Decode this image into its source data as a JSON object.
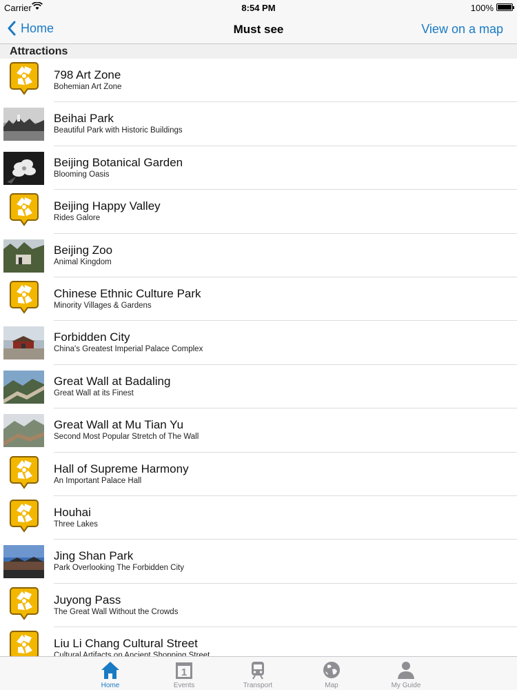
{
  "status_bar": {
    "carrier": "Carrier",
    "time": "8:54 PM",
    "battery": "100%"
  },
  "nav": {
    "back_label": "Home",
    "title": "Must see",
    "action_label": "View on a map"
  },
  "section": {
    "title": "Attractions"
  },
  "items": [
    {
      "title": "798 Art Zone",
      "subtitle": "Bohemian Art Zone",
      "thumb": "pin"
    },
    {
      "title": "Beihai Park",
      "subtitle": "Beautiful Park with Historic Buildings",
      "thumb": "photo-lake"
    },
    {
      "title": "Beijing Botanical Garden",
      "subtitle": "Blooming Oasis",
      "thumb": "photo-flower"
    },
    {
      "title": "Beijing Happy Valley",
      "subtitle": "Rides Galore",
      "thumb": "pin"
    },
    {
      "title": "Beijing Zoo",
      "subtitle": "Animal Kingdom",
      "thumb": "photo-zoo"
    },
    {
      "title": "Chinese Ethnic Culture Park",
      "subtitle": "Minority Villages & Gardens",
      "thumb": "pin"
    },
    {
      "title": "Forbidden City",
      "subtitle": "China's Greatest Imperial Palace Complex",
      "thumb": "photo-palace"
    },
    {
      "title": "Great Wall at Badaling",
      "subtitle": "Great Wall at its Finest",
      "thumb": "photo-wall"
    },
    {
      "title": "Great Wall at Mu Tian Yu",
      "subtitle": "Second Most Popular Stretch of The Wall",
      "thumb": "photo-wall2"
    },
    {
      "title": "Hall of Supreme Harmony",
      "subtitle": "An Important Palace Hall",
      "thumb": "pin"
    },
    {
      "title": "Houhai",
      "subtitle": "Three Lakes",
      "thumb": "pin"
    },
    {
      "title": "Jing Shan Park",
      "subtitle": "Park Overlooking The Forbidden City",
      "thumb": "photo-crowd"
    },
    {
      "title": "Juyong Pass",
      "subtitle": "The Great Wall Without the Crowds",
      "thumb": "pin"
    },
    {
      "title": "Liu Li Chang Cultural Street",
      "subtitle": "Cultural Artifacts on Ancient Shopping Street",
      "thumb": "pin"
    }
  ],
  "tabs": [
    {
      "label": "Home",
      "icon": "home-icon",
      "active": true
    },
    {
      "label": "Events",
      "icon": "calendar-icon",
      "active": false
    },
    {
      "label": "Transport",
      "icon": "train-icon",
      "active": false
    },
    {
      "label": "Map",
      "icon": "globe-icon",
      "active": false
    },
    {
      "label": "My Guide",
      "icon": "person-icon",
      "active": false
    }
  ],
  "colors": {
    "accent": "#1a7ac3",
    "pin_fill": "#f2b700",
    "pin_border": "#8a6200",
    "tab_inactive": "#8e8e93"
  }
}
